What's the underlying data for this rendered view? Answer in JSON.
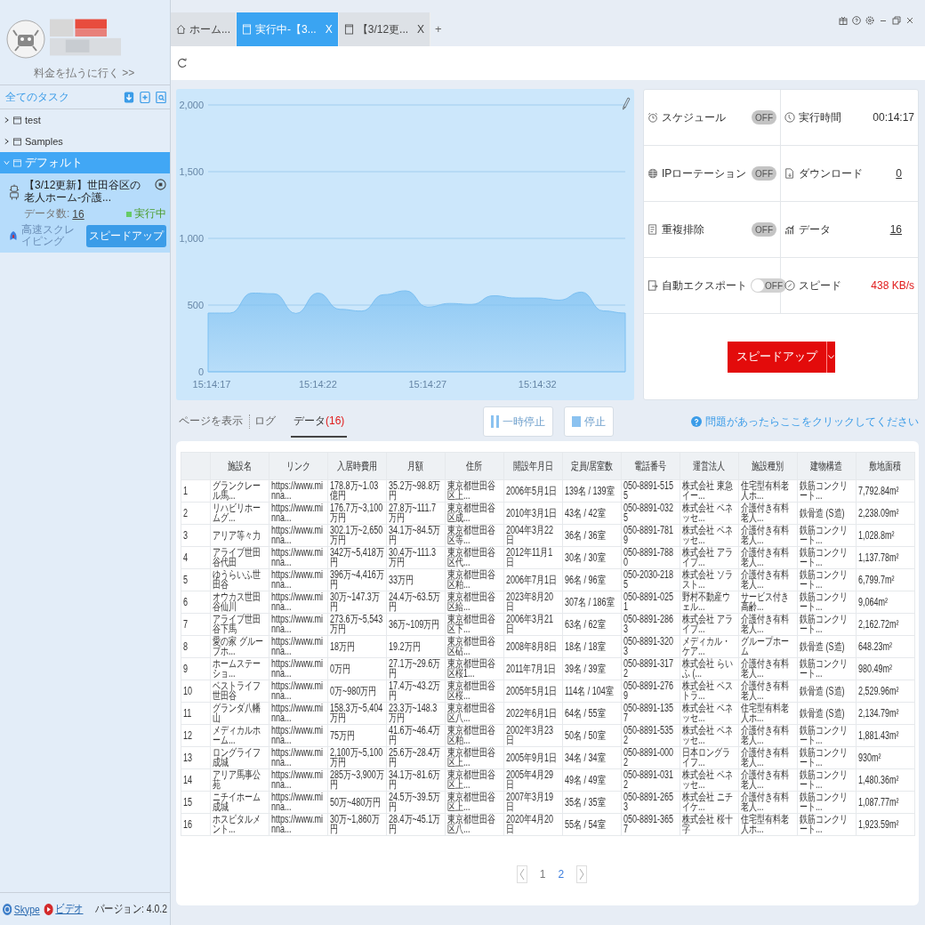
{
  "account": {
    "pay_link": "料金を払うに行く >>"
  },
  "tabs": [
    {
      "kind": "home",
      "label": "ホーム...",
      "selected": false
    },
    {
      "kind": "task",
      "label": "実行中-【3...",
      "close": "X",
      "selected": true
    },
    {
      "kind": "task",
      "label": "【3/12更...",
      "close": "X",
      "selected": false
    }
  ],
  "new_tab": "+",
  "sidebar": {
    "title": "全てのタスク",
    "folders": [
      {
        "name": "test",
        "expanded": false,
        "selected": false
      },
      {
        "name": "Samples",
        "expanded": false,
        "selected": false
      },
      {
        "name": "デフォルト",
        "expanded": true,
        "selected": true,
        "children": [
          {
            "title": "【3/12更新】世田谷区の老人ホーム-介護...",
            "count_label": "データ数:",
            "count": "16",
            "status": "実行中",
            "color": "#66cc66",
            "mode": "高速スクレイピング",
            "button": "スピードアップ"
          }
        ]
      }
    ],
    "footer": {
      "links": [
        {
          "kind": "skype",
          "label": "Skype"
        },
        {
          "kind": "video",
          "label": "ビデオ"
        }
      ],
      "version": "バージョン: 4.0.2"
    }
  },
  "chart": {
    "chart_data": {
      "type": "area",
      "categories": [
        "15:14:17",
        null,
        null,
        null,
        null,
        "15:14:22",
        null,
        null,
        null,
        null,
        "15:14:27",
        null,
        null,
        null,
        null,
        "15:14:32",
        null,
        null,
        null,
        null
      ],
      "series": [
        {
          "color": "#7cc0f2",
          "values": [
            440,
            440,
            590,
            585,
            437,
            590,
            468,
            455,
            578,
            607,
            485,
            512,
            505,
            570,
            553,
            553,
            537,
            597,
            456,
            440
          ]
        }
      ],
      "ylim": [
        0,
        2000
      ],
      "yticks": [
        0,
        500,
        {
          "value": 1000,
          "label": "1,000"
        },
        {
          "value": 1500,
          "label": "1,500"
        },
        {
          "value": 2000,
          "label": "2,000"
        }
      ],
      "grid": true
    }
  },
  "stats": {
    "settings": [
      {
        "label": "スケジュール",
        "toggle": "OFF",
        "on": false,
        "disabled": true
      },
      {
        "label": "IPローテーション",
        "toggle": "OFF",
        "on": false,
        "disabled": true
      },
      {
        "label": "重複排除",
        "toggle": "OFF",
        "on": false,
        "disabled": true
      },
      {
        "label": "自動エクスポート",
        "toggle": "OFF",
        "on": false,
        "disabled": false
      }
    ],
    "metrics": [
      {
        "label": "実行時間",
        "value": "00:14:17",
        "kind": "plain"
      },
      {
        "label": "ダウンロード",
        "value": "0",
        "kind": "link"
      },
      {
        "label": "データ",
        "value": "16",
        "kind": "link"
      },
      {
        "label": "スピード",
        "value": "438 KB/s",
        "kind": "alert"
      }
    ],
    "speed_button": "スピードアップ"
  },
  "view_tabs": [
    {
      "label": "ページを表示",
      "selected": false
    },
    {
      "label": "ログ",
      "selected": false
    },
    {
      "label": "データ",
      "count": "(16)",
      "selected": true
    }
  ],
  "controls": {
    "pause": "一時停止",
    "stop": "停止",
    "help": "問題があったらここをクリックしてください"
  },
  "table": {
    "columns": [
      "",
      "施設名",
      "リンク",
      "入居時費用",
      "月額",
      "住所",
      "開設年月日",
      "定員/居室数",
      "電話番号",
      "運営法人",
      "施設種別",
      "建物構造",
      "敷地面積"
    ],
    "rows": [
      [
        "1",
        "グランクレール馬...",
        "https://www.minna...",
        "178.8万~1.03億円",
        "35.2万~98.8万円",
        "東京都世田谷区上...",
        "2006年5月1日",
        "139名 / 139室",
        "050-8891-5155",
        "株式会社 東急イー...",
        "住宅型有料老人ホ...",
        "鉄筋コンクリート...",
        "7,792.84m²"
      ],
      [
        "2",
        "リハビリホームグ...",
        "https://www.minna...",
        "176.7万~3,100万円",
        "27.8万~111.7万円",
        "東京都世田谷区成...",
        "2010年3月1日",
        "43名 / 42室",
        "050-8891-0325",
        "株式会社 ベネッセ...",
        "介護付き有料老人...",
        "鉄骨造 (S造)",
        "2,238.09m²"
      ],
      [
        "3",
        "アリア等々力",
        "https://www.minna...",
        "302.1万~2,650万円",
        "34.1万~84.5万円",
        "東京都世田谷区等...",
        "2004年3月22日",
        "36名 / 36室",
        "050-8891-7819",
        "株式会社 ベネッセ...",
        "介護付き有料老人...",
        "鉄筋コンクリート...",
        "1,028.8m²"
      ],
      [
        "4",
        "アライブ世田谷代田",
        "https://www.minna...",
        "342万~5,418万円",
        "30.4万~111.3万円",
        "東京都世田谷区代...",
        "2012年11月1日",
        "30名 / 30室",
        "050-8891-7880",
        "株式会社 アライブ...",
        "介護付き有料老人...",
        "鉄筋コンクリート...",
        "1,137.78m²"
      ],
      [
        "5",
        "ゆうらいふ世田谷",
        "https://www.minna...",
        "396万~4,416万円",
        "33万円",
        "東京都世田谷区粕...",
        "2006年7月1日",
        "96名 / 96室",
        "050-2030-2185",
        "株式会社 ソラスト...",
        "介護付き有料老人...",
        "鉄筋コンクリート...",
        "6,799.7m²"
      ],
      [
        "6",
        "オウカス世田谷仙川",
        "https://www.minna...",
        "30万~147.3万円",
        "24.4万~63.5万円",
        "東京都世田谷区給...",
        "2023年8月20日",
        "307名 / 186室",
        "050-8891-0251",
        "野村不動産ウェル...",
        "サービス付き高齢...",
        "鉄筋コンクリート...",
        "9,064m²"
      ],
      [
        "7",
        "アライブ世田谷下馬",
        "https://www.minna...",
        "273.6万~5,543万円",
        "36万~109万円",
        "東京都世田谷区下...",
        "2006年3月21日",
        "63名 / 62室",
        "050-8891-2863",
        "株式会社 アライブ...",
        "介護付き有料老人...",
        "鉄筋コンクリート...",
        "2,162.72m²"
      ],
      [
        "8",
        "愛の家 グループホ...",
        "https://www.minna...",
        "18万円",
        "19.2万円",
        "東京都世田谷区砧...",
        "2008年8月8日",
        "18名 / 18室",
        "050-8891-3203",
        "メディカル・ケア...",
        "グループホーム",
        "鉄骨造 (S造)",
        "648.23m²"
      ],
      [
        "9",
        "ホームステーショ...",
        "https://www.minna...",
        "0万円",
        "27.1万~29.6万円",
        "東京都世田谷区桜1...",
        "2011年7月1日",
        "39名 / 39室",
        "050-8891-3172",
        "株式会社 らいふ (...",
        "介護付き有料老人...",
        "鉄筋コンクリート...",
        "980.49m²"
      ],
      [
        "10",
        "ベストライフ世田谷",
        "https://www.minna...",
        "0万~980万円",
        "17.4万~43.2万円",
        "東京都世田谷区桜...",
        "2005年5月1日",
        "114名 / 104室",
        "050-8891-2769",
        "株式会社 ベストラ...",
        "介護付き有料老人...",
        "鉄骨造 (S造)",
        "2,529.96m²"
      ],
      [
        "11",
        "グランダ八幡山",
        "https://www.minna...",
        "158.3万~5,404万円",
        "23.3万~148.3万円",
        "東京都世田谷区八...",
        "2022年6月1日",
        "64名 / 55室",
        "050-8891-1357",
        "株式会社 ベネッセ...",
        "住宅型有料老人ホ...",
        "鉄骨造 (S造)",
        "2,134.79m²"
      ],
      [
        "12",
        "メディカルホーム...",
        "https://www.minna...",
        "75万円",
        "41.6万~46.4万円",
        "東京都世田谷区粕...",
        "2002年3月23日",
        "50名 / 50室",
        "050-8891-5352",
        "株式会社 ベネッセ...",
        "介護付き有料老人...",
        "鉄筋コンクリート...",
        "1,881.43m²"
      ],
      [
        "13",
        "ロングライフ成城",
        "https://www.minna...",
        "2,100万~5,100万円",
        "25.6万~28.4万円",
        "東京都世田谷区上...",
        "2005年9月1日",
        "34名 / 34室",
        "050-8891-0002",
        "日本ロングライフ...",
        "介護付き有料老人...",
        "鉄筋コンクリート...",
        "930m²"
      ],
      [
        "14",
        "アリア馬事公苑",
        "https://www.minna...",
        "285万~3,900万円",
        "34.1万~81.6万円",
        "東京都世田谷区上...",
        "2005年4月29日",
        "49名 / 49室",
        "050-8891-0312",
        "株式会社 ベネッセ...",
        "介護付き有料老人...",
        "鉄筋コンクリート...",
        "1,480.36m²"
      ],
      [
        "15",
        "ニチイホーム成城",
        "https://www.minna...",
        "50万~480万円",
        "24.5万~39.5万円",
        "東京都世田谷区上...",
        "2007年3月19日",
        "35名 / 35室",
        "050-8891-2653",
        "株式会社 ニチイケ...",
        "介護付き有料老人...",
        "鉄筋コンクリート...",
        "1,087.77m²"
      ],
      [
        "16",
        "ホスピタルメント...",
        "https://www.minna...",
        "30万~1,860万円",
        "28.4万~45.1万円",
        "東京都世田谷区八...",
        "2020年4月20日",
        "55名 / 54室",
        "050-8891-3657",
        "株式会社 桜十字",
        "住宅型有料老人ホ...",
        "鉄筋コンクリート...",
        "1,923.59m²"
      ]
    ]
  },
  "pagination": {
    "pages": [
      {
        "label": "1",
        "selected": false
      },
      {
        "label": "2",
        "selected": true
      }
    ]
  }
}
